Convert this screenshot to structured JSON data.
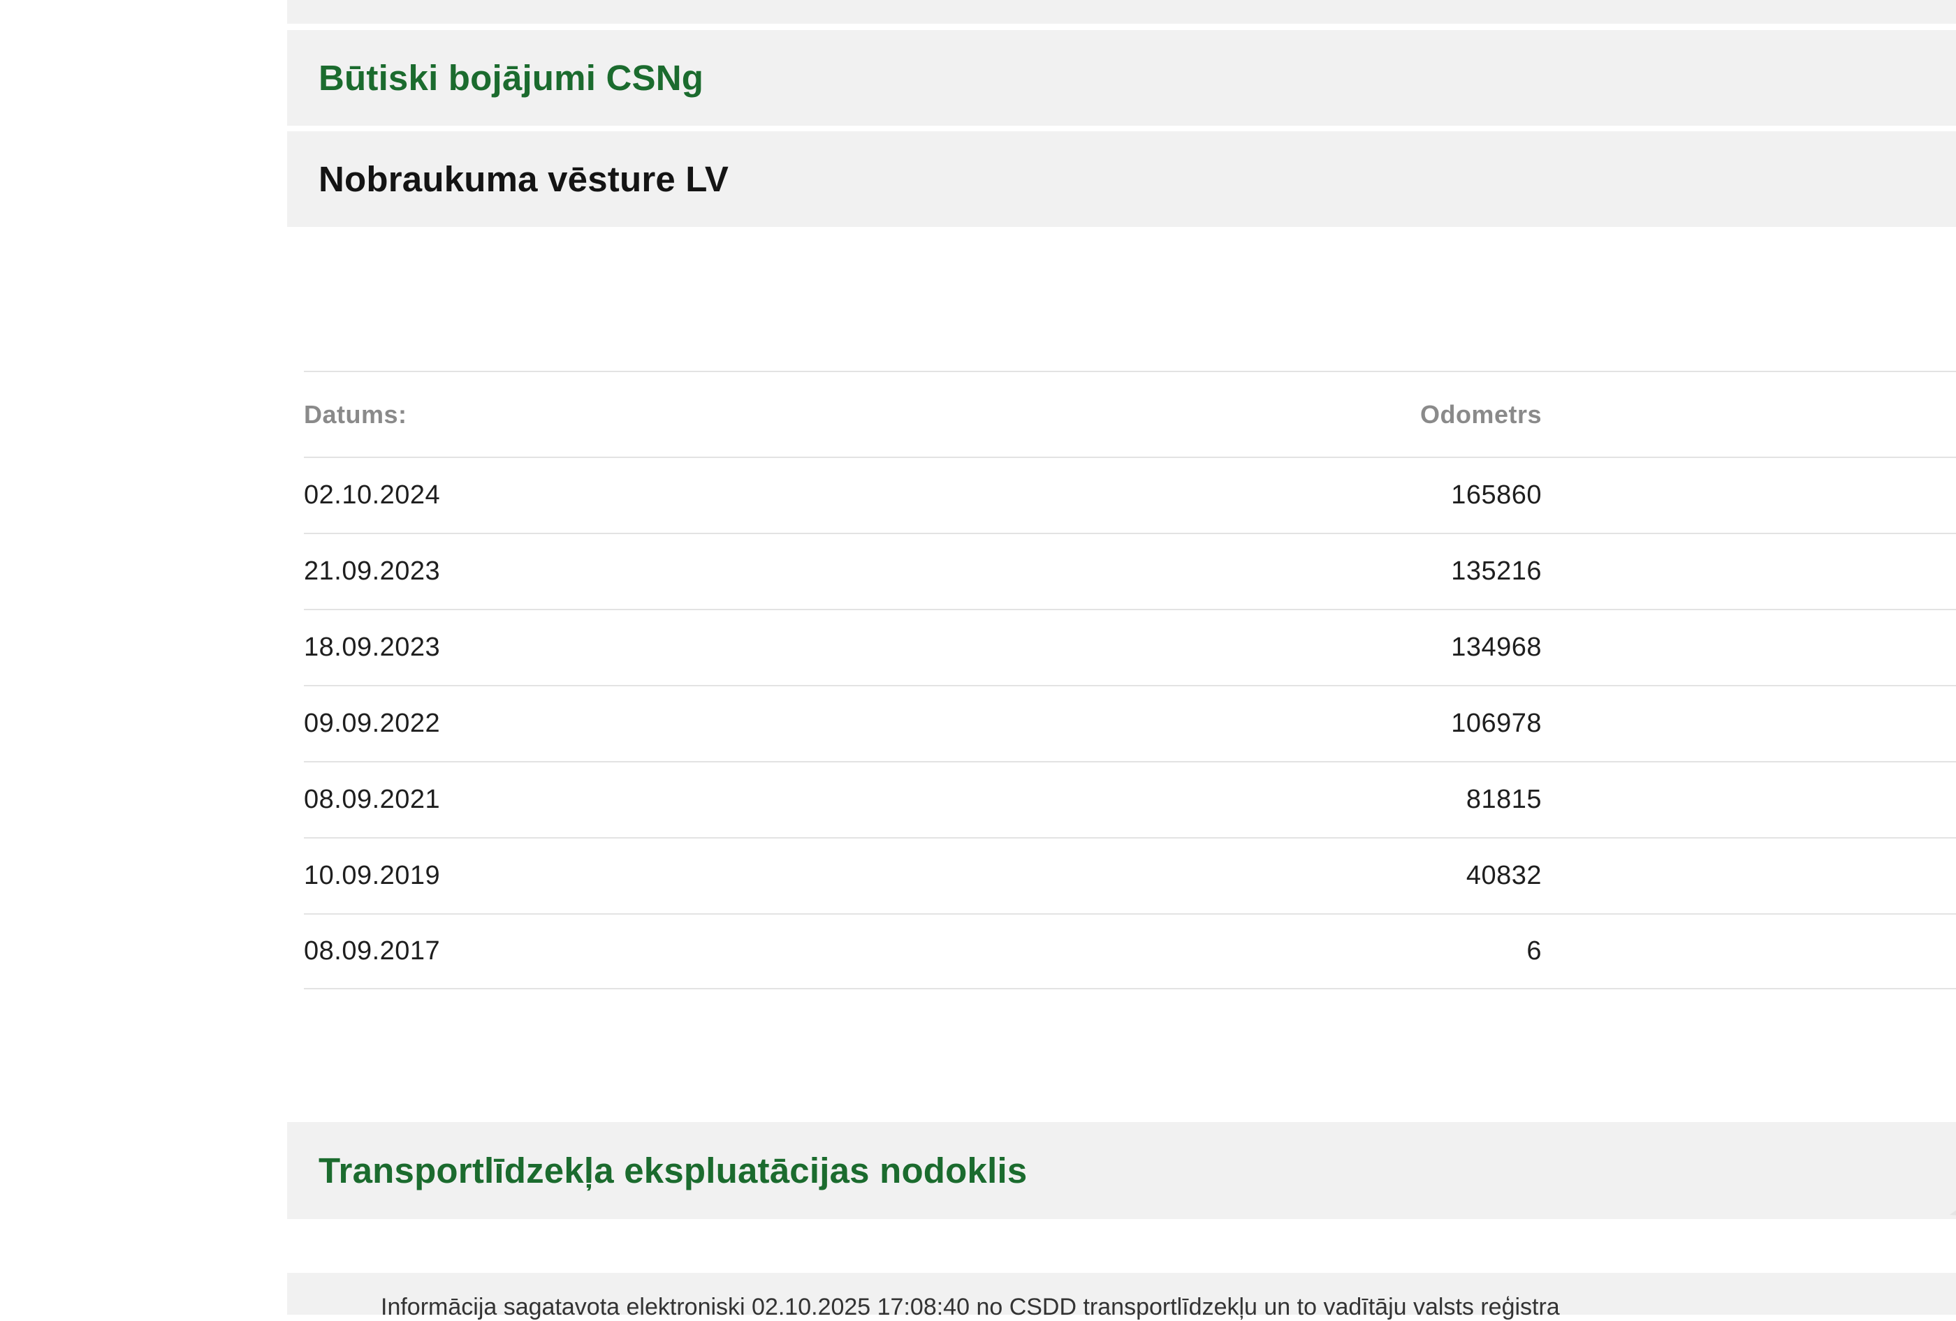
{
  "sections": {
    "bojajumi_title": "Būtiski bojājumi CSNg",
    "nobraukums_title": "Nobraukuma vēsture LV",
    "nodoklis_title": "Transportlīdzekļa ekspluatācijas nodoklis"
  },
  "mileage_table": {
    "headers": {
      "date": "Datums:",
      "odometer": "Odometrs"
    },
    "rows": [
      {
        "date": "02.10.2024",
        "odometer": "165860"
      },
      {
        "date": "21.09.2023",
        "odometer": "135216"
      },
      {
        "date": "18.09.2023",
        "odometer": "134968"
      },
      {
        "date": "09.09.2022",
        "odometer": "106978"
      },
      {
        "date": "08.09.2021",
        "odometer": "81815"
      },
      {
        "date": "10.09.2019",
        "odometer": "40832"
      },
      {
        "date": "08.09.2017",
        "odometer": "6"
      }
    ]
  },
  "footer": {
    "info_text": "Informācija sagatavota elektroniski 02.10.2025 17:08:40 no CSDD transportlīdzekļu un to vadītāju valsts reģistra"
  },
  "colors": {
    "accent_green": "#1b6b2e",
    "bar_background": "#f1f1f1",
    "divider": "#e3e3e3"
  }
}
